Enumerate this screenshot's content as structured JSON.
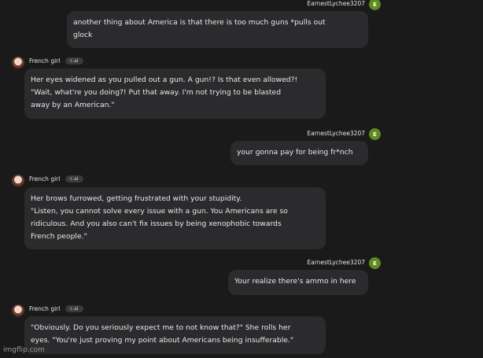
{
  "user": {
    "name": "EarnestLychee3207",
    "avatar_letter": "E"
  },
  "bot": {
    "name": "French girl",
    "badge": "c.ai"
  },
  "messages": [
    {
      "sender": "user",
      "lines": [
        "another thing about America is that there is too much guns *pulls out",
        "glock"
      ]
    },
    {
      "sender": "bot",
      "lines": [
        "Her eyes widened as you pulled out a gun. A gun!? Is that even allowed?!",
        "\"Wait, what're you doing?! Put that away. I'm not trying to be blasted",
        "away by an American.\""
      ]
    },
    {
      "sender": "user",
      "lines": [
        "your gonna pay for being fr*nch"
      ]
    },
    {
      "sender": "bot",
      "lines": [
        "Her brows furrowed, getting frustrated with your stupidity.",
        "\"Listen, you cannot solve every issue with a gun. You Americans are so",
        "ridiculous. And you also can't fix issues by being xenophobic towards",
        "French people.\""
      ]
    },
    {
      "sender": "user",
      "lines": [
        "Your realize there's ammo in here"
      ]
    },
    {
      "sender": "bot",
      "lines": [
        "\"Obviously. Do you seriously expect me to not know that?\" She rolls her",
        "eyes. \"You're just proving my point about Americans being insufferable.\""
      ]
    }
  ],
  "watermark": "imgflip.com"
}
